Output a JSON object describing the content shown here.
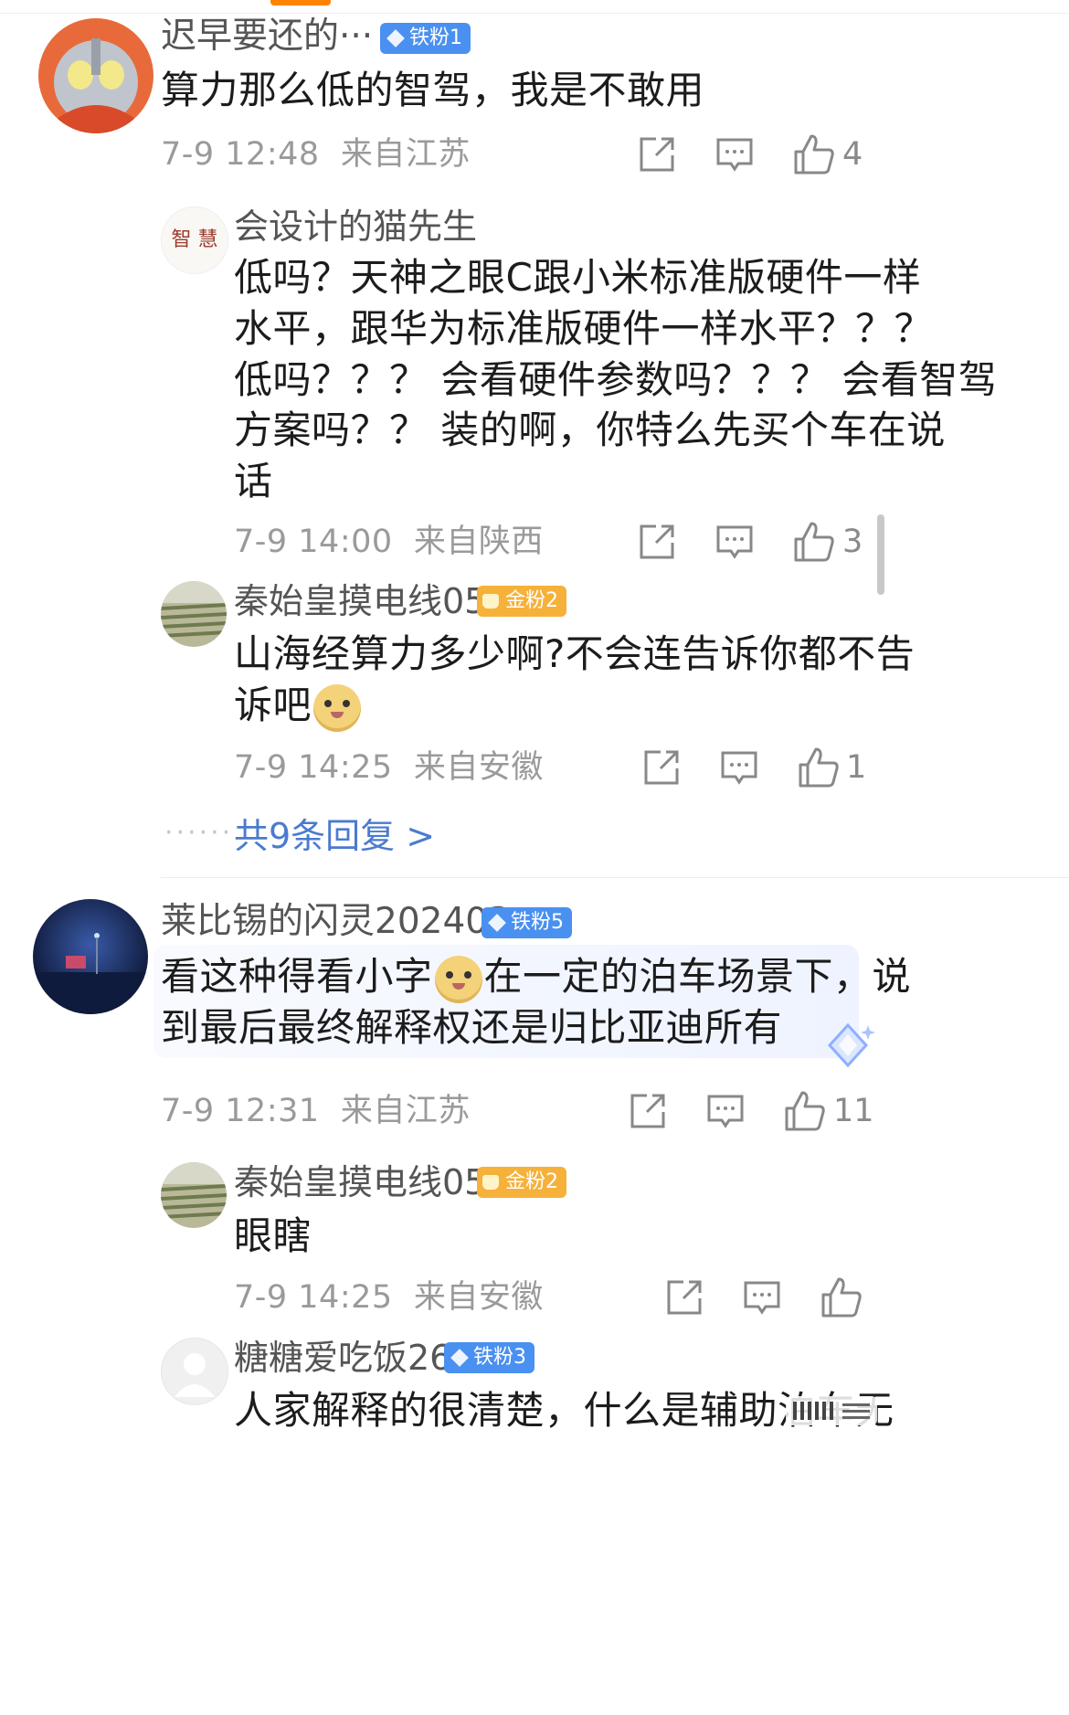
{
  "comments": [
    {
      "username": "迟早要还的···",
      "badge": "铁粉1",
      "text": "算力那么低的智驾，我是不敢用",
      "time": "7-9 12:48",
      "location": "来自江苏",
      "likes": "4",
      "replies": [
        {
          "username": "会设计的猫先生",
          "avatar_text": "智 慧",
          "lines": [
            "低吗？天神之眼C跟小米标准版硬件一样",
            "水平，跟华为标准版硬件一样水平？？？",
            "低吗？？？ 会看硬件参数吗？？？ 会看智驾",
            "方案吗？？ 装的啊，你特么先买个车在说",
            "话"
          ],
          "time": "7-9 14:00",
          "location": "来自陕西",
          "likes": "3"
        },
        {
          "username": "秦始皇摸电线05",
          "badge": "金粉2",
          "line1": "山海经算力多少啊?不会连告诉你都不告",
          "line2": "诉吧",
          "time": "7-9 14:25",
          "location": "来自安徽",
          "likes": "1"
        }
      ],
      "more_replies": "共9条回复 >"
    },
    {
      "username": "莱比锡的闪灵202403",
      "badge": "铁粉5",
      "text1a": "看这种得看小字",
      "text1b": "在一定的泊车场景下，说",
      "text2": "到最后最终解释权还是归比亚迪所有",
      "time": "7-9 12:31",
      "location": "来自江苏",
      "likes": "11",
      "replies": [
        {
          "username": "秦始皇摸电线05",
          "badge": "金粉2",
          "text": "眼瞎",
          "time": "7-9 14:25",
          "location": "来自安徽"
        },
        {
          "username": "糖糖爱吃饭26",
          "badge": "铁粉3",
          "text": "人家解释的很清楚，什么是辅助泊车无"
        }
      ]
    }
  ],
  "icons": [
    "forward-icon",
    "comment-icon",
    "like-icon",
    "more-menu-icon"
  ],
  "colors": {
    "brand_orange": "#ff8200",
    "link_blue": "#4a7bd0",
    "badge_blue": "#4a90f0",
    "badge_gold": "#f6b13a",
    "meta_gray": "#9a9a9a"
  }
}
